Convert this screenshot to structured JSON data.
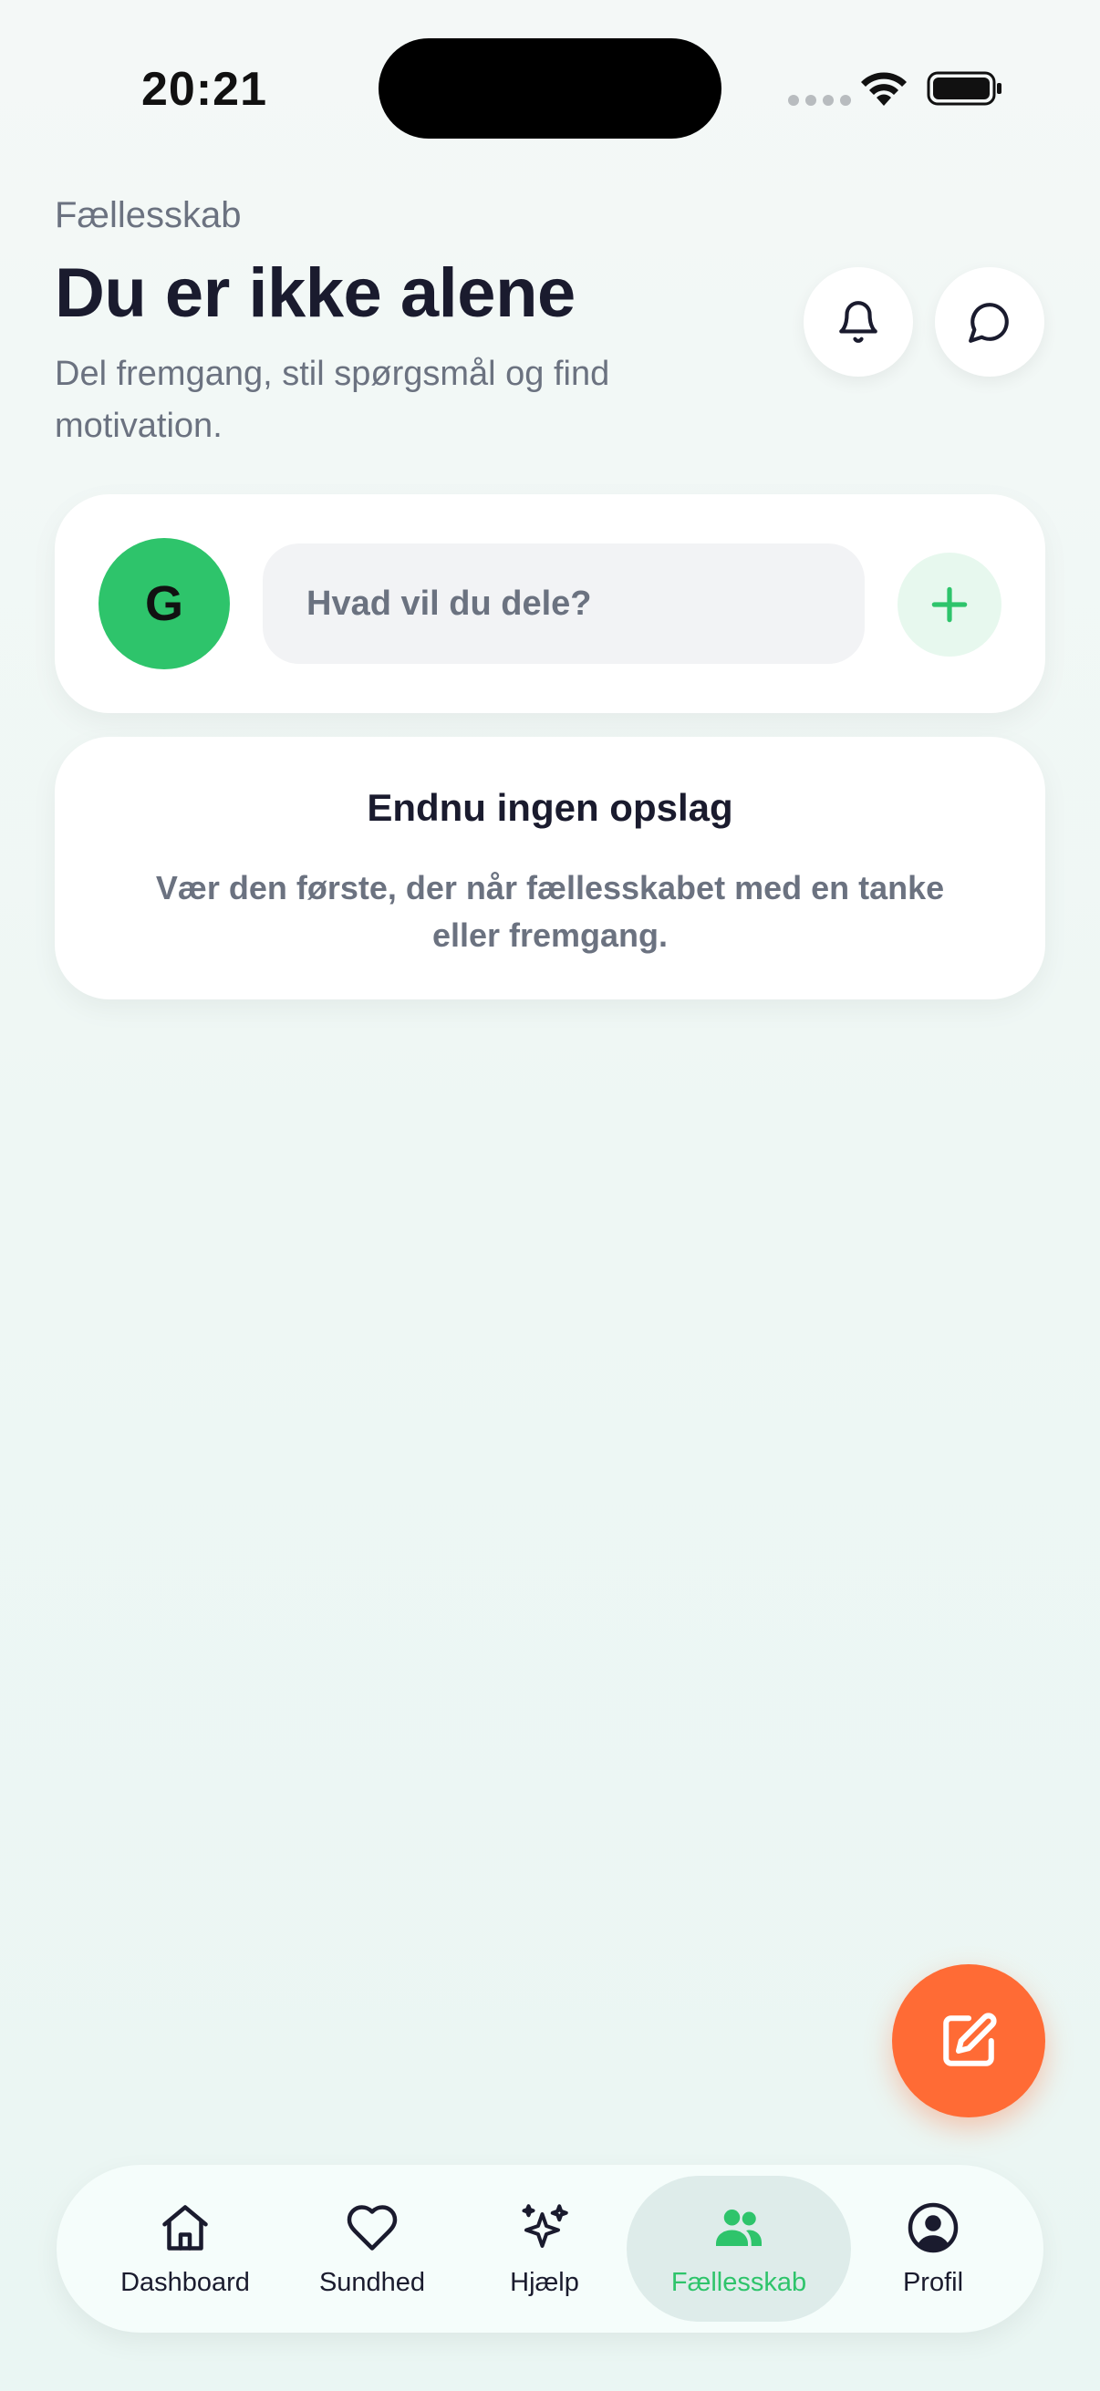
{
  "status_bar": {
    "time": "20:21"
  },
  "header": {
    "eyebrow": "Fællesskab",
    "title": "Du er ikke alene",
    "subtitle": "Del fremgang, stil spørgsmål og find motivation."
  },
  "composer": {
    "avatar_initial": "G",
    "placeholder": "Hvad vil du dele?"
  },
  "empty_state": {
    "title": "Endnu ingen opslag",
    "text": "Vær den første, der når fællesskabet med en tanke eller fremgang."
  },
  "bottom_nav": {
    "items": [
      {
        "label": "Dashboard",
        "icon": "home-icon"
      },
      {
        "label": "Sundhed",
        "icon": "heart-icon"
      },
      {
        "label": "Hjælp",
        "icon": "sparkles-icon"
      },
      {
        "label": "Fællesskab",
        "icon": "people-icon",
        "active": true
      },
      {
        "label": "Profil",
        "icon": "user-circle-icon"
      }
    ]
  },
  "colors": {
    "accent_green": "#2ec46b",
    "fab_orange": "#ff6b35",
    "text_dark": "#1a1b2e",
    "text_muted": "#6b7280"
  },
  "icons": {
    "bell": "bell-icon",
    "chat": "chat-bubble-icon",
    "add": "plus-icon",
    "fab": "compose-icon"
  }
}
